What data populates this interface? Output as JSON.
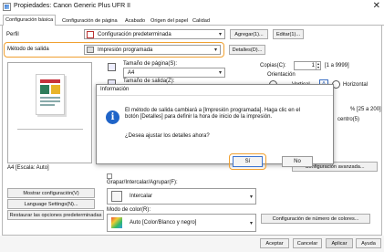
{
  "window": {
    "title": "Propiedades: Canon Generic Plus UFR II"
  },
  "tabs": [
    "Configuración básica",
    "Configuración de página",
    "Acabado",
    "Origen del papel",
    "Calidad"
  ],
  "perfil": {
    "label": "Perfil",
    "value": "Configuración predeterminada",
    "add_button": "Agregar(1)...",
    "edit_button": "Editar(1)..."
  },
  "metodo": {
    "label": "Método de salida",
    "value": "Impresión programada",
    "details_button": "Detalles(D)..."
  },
  "page": {
    "size_label": "Tamaño de página(S):",
    "size_value": "A4",
    "output_label": "Tamaño de salida(Z):",
    "copies_label": "Copias(C):",
    "copies_value": "1",
    "copies_range": "[1 a 9999]",
    "orientation_label": "Orientación",
    "vertical": "Vertical",
    "horizontal": "Horizontal",
    "zoom_range": "% [25 a 200]",
    "centro": "centro(5)"
  },
  "preview": {
    "caption": "A4 [Escala: Auto]"
  },
  "left_buttons": {
    "show_settings": "Mostrar configuración(V)",
    "language": "Language Settings(N)...",
    "restore": "Restaurar las opciones predeterminadas"
  },
  "group": {
    "label": "Grapar/Intercalar/Agrupar(F):",
    "value": "Intercalar",
    "color_label": "Modo de color(R):",
    "color_value": "Auto [Color/Blanco y negro]",
    "color_button": "Configuración de número de colores...",
    "avanzadas": "Configuración avanzada..."
  },
  "dialog": {
    "title": "Información",
    "message": "El método de salida cambiará a [Impresión programada]. Haga clic en el botón [Detalles] para definir la hora de inicio de la impresión.",
    "question": "¿Desea ajustar los detalles ahora?",
    "yes": "Sí",
    "no": "No"
  },
  "footer": {
    "accept": "Aceptar",
    "cancel": "Cancelar",
    "apply": "Aplicar",
    "help": "Ayuda"
  },
  "colors": {
    "highlight": "#f0a030",
    "info_icon": "#1f64c8"
  }
}
